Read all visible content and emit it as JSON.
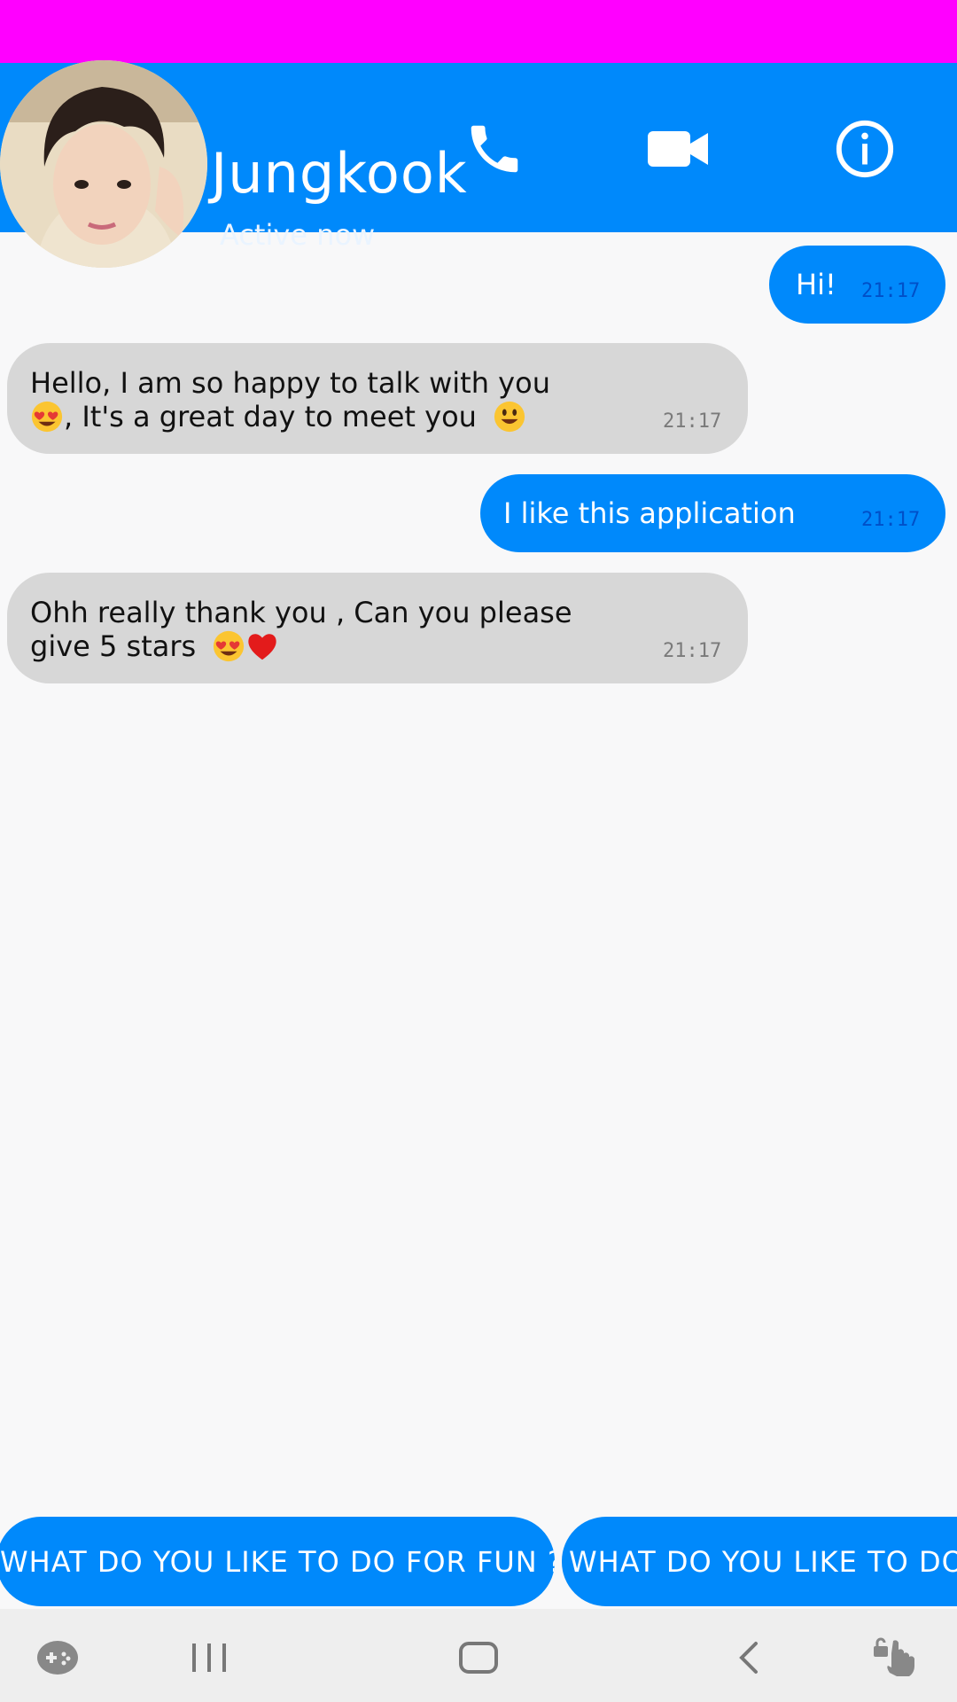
{
  "colors": {
    "status_bar": "#ff00ff",
    "header": "#0089fb",
    "outgoing_bubble": "#0089fb",
    "incoming_bubble": "#d7d7d7",
    "background": "#f8f8f9",
    "nav_bar": "#eeeeee"
  },
  "header": {
    "contact_name": "Jungkook",
    "status": "Active now",
    "icons": [
      "avatar",
      "phone-icon",
      "video-call-icon",
      "info-icon"
    ]
  },
  "messages": [
    {
      "direction": "outgoing",
      "text": "Hi!",
      "time": "21:17"
    },
    {
      "direction": "incoming",
      "line1": "Hello, I am so happy to talk with you",
      "line2": ", It's a great day to meet you",
      "time": "21:17"
    },
    {
      "direction": "outgoing",
      "text": "I like this application",
      "time": "21:17"
    },
    {
      "direction": "incoming",
      "line1": "Ohh really thank you , Can you please",
      "line2": "give 5 stars",
      "time": "21:17"
    }
  ],
  "suggestions": [
    "WHAT DO YOU LIKE TO DO FOR FUN ?",
    "WHAT DO YOU LIKE TO DO"
  ],
  "nav_bar": {
    "icons": [
      "game-launcher-icon",
      "recent-apps-icon",
      "home-icon",
      "back-icon",
      "touch-lock-icon"
    ]
  }
}
